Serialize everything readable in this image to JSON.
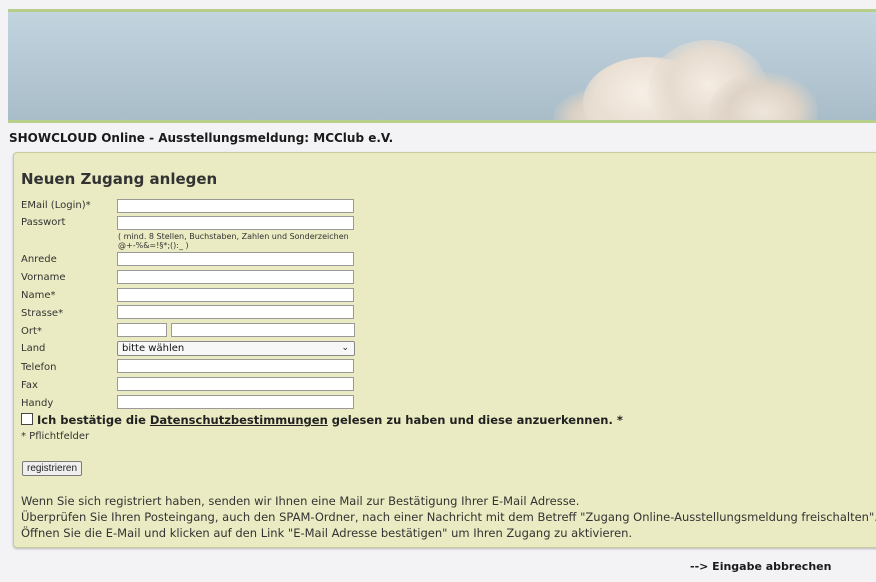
{
  "header": {
    "title": "SHOWCLOUD Online - Ausstellungsmeldung: MCClub e.V."
  },
  "form": {
    "title": "Neuen Zugang anlegen",
    "labels": {
      "email": "EMail (Login)*",
      "password": "Passwort",
      "anrede": "Anrede",
      "vorname": "Vorname",
      "name": "Name*",
      "strasse": "Strasse*",
      "ort": "Ort*",
      "land": "Land",
      "telefon": "Telefon",
      "fax": "Fax",
      "handy": "Handy"
    },
    "password_hint": "( mind. 8 Stellen, Buchstaben, Zahlen und Sonderzeichen @+-%&=!§*;():_ )",
    "land_select_value": "bitte wählen",
    "consent": {
      "before": "Ich bestätige die ",
      "link": "Datenschutzbestimmungen",
      "after": " gelesen zu haben und diese anzuerkennen. *"
    },
    "required_note": "* Pflichtfelder",
    "submit_label": "registrieren",
    "info_lines": [
      "Wenn Sie sich registriert haben, senden wir Ihnen eine Mail zur Bestätigung Ihrer E-Mail Adresse.",
      "Überprüfen Sie Ihren Posteingang, auch den SPAM-Ordner, nach einer Nachricht mit dem Betreff \"Zugang Online-Ausstellungsmeldung freischalten\".",
      "Öffnen Sie die E-Mail und klicken auf den Link \"E-Mail Adresse bestätigen\" um Ihren Zugang zu aktivieren."
    ]
  },
  "footer": {
    "cancel_label": "--> Eingabe abbrechen"
  }
}
